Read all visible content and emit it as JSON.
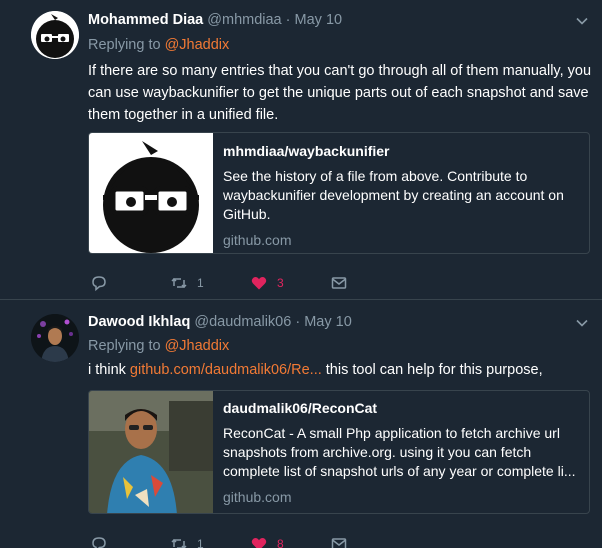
{
  "tweets": [
    {
      "name": "Mohammed Diaa",
      "handle": "@mhmdiaa",
      "separator": "·",
      "date": "May 10",
      "reply_prefix": "Replying to",
      "reply_to": "@Jhaddix",
      "text": "If there are so many entries that you can't go through all of them manually, you can use waybackunifier to get the unique parts out of each snapshot and save them together in a unified file.",
      "card": {
        "title": "mhmdiaa/waybackunifier",
        "description": "See the history of a file from above. Contribute to waybackunifier development by creating an account on GitHub.",
        "domain": "github.com"
      },
      "retweets": "1",
      "likes": "3"
    },
    {
      "name": "Dawood Ikhlaq",
      "handle": "@daudmalik06",
      "separator": "·",
      "date": "May 10",
      "reply_prefix": "Replying to",
      "reply_to": "@Jhaddix",
      "text_before": "i think ",
      "text_link": "github.com/daudmalik06/Re...",
      "text_after": " this tool can help for this purpose,",
      "card": {
        "title": "daudmalik06/ReconCat",
        "description": "ReconCat - A small Php application to fetch archive url snapshots from archive.org. using it you can fetch complete list of snapshot urls of any year or complete li...",
        "domain": "github.com"
      },
      "retweets": "1",
      "likes": "8"
    }
  ],
  "icons": {
    "reply": "reply-icon",
    "retweet": "retweet-icon",
    "like": "heart-icon",
    "dm": "envelope-icon",
    "menu": "chevron-down-icon"
  },
  "colors": {
    "background": "#1c2733",
    "accent": "#f27a35",
    "like": "#e0245e",
    "secondary_text": "#8899a6",
    "border": "#38444d"
  }
}
